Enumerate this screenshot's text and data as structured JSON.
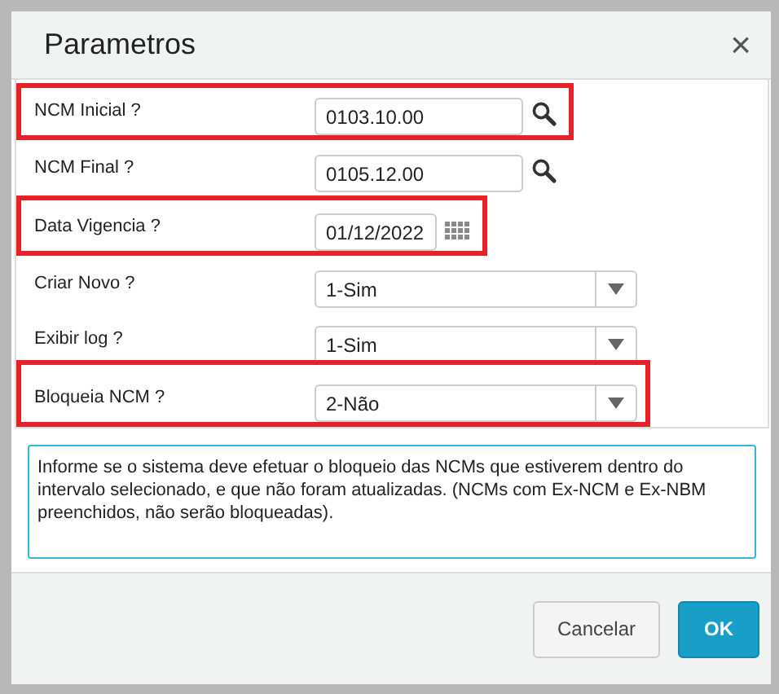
{
  "dialog": {
    "title": "Parametros",
    "close": "×"
  },
  "fields": [
    {
      "label": "NCM Inicial ?",
      "kind": "lookup",
      "value": "0103.10.00",
      "highlighted": true
    },
    {
      "label": "NCM Final ?",
      "kind": "lookup",
      "value": "0105.12.00",
      "highlighted": false
    },
    {
      "label": "Data Vigencia ?",
      "kind": "date",
      "value": "01/12/2022",
      "highlighted": true
    },
    {
      "label": "Criar Novo ?",
      "kind": "select",
      "value": "1-Sim",
      "highlighted": false
    },
    {
      "label": "Exibir log ?",
      "kind": "select",
      "value": "1-Sim",
      "highlighted": false
    },
    {
      "label": "Bloqueia NCM ?",
      "kind": "select",
      "value": "2-Não",
      "highlighted": true
    }
  ],
  "help": "Informe se o sistema deve efetuar o bloqueio das NCMs que estiverem dentro do intervalo selecionado, e que não foram atualizadas. (NCMs com Ex-NCM e Ex-NBM preenchidos, não serão bloqueadas).",
  "buttons": [
    {
      "label": "Cancelar",
      "kind": "secondary"
    },
    {
      "label": "OK",
      "kind": "primary"
    }
  ]
}
